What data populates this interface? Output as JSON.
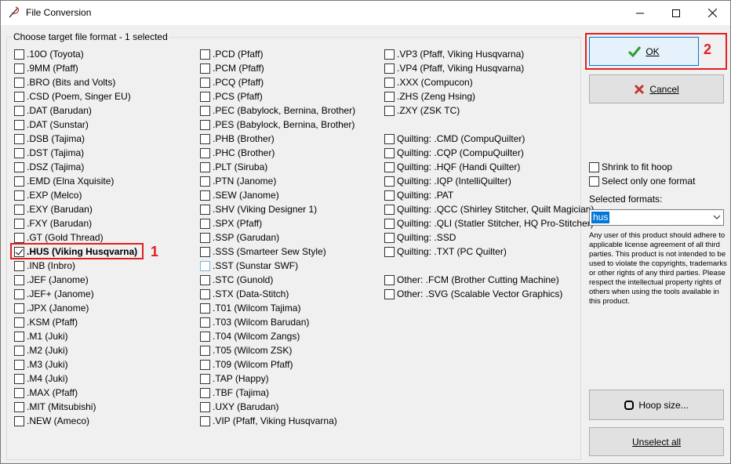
{
  "window": {
    "title": "File Conversion",
    "controls": {
      "minimize": "minimize-icon",
      "maximize": "maximize-icon",
      "close": "close-icon"
    }
  },
  "group": {
    "label": "Choose target file format - 1 selected"
  },
  "columns": [
    [
      {
        "label": ".10O (Toyota)",
        "checked": false
      },
      {
        "label": ".9MM (Pfaff)",
        "checked": false
      },
      {
        "label": ".BRO (Bits and Volts)",
        "checked": false
      },
      {
        "label": ".CSD (Poem, Singer EU)",
        "checked": false
      },
      {
        "label": ".DAT (Barudan)",
        "checked": false
      },
      {
        "label": ".DAT (Sunstar)",
        "checked": false
      },
      {
        "label": ".DSB (Tajima)",
        "checked": false
      },
      {
        "label": ".DST (Tajima)",
        "checked": false
      },
      {
        "label": ".DSZ (Tajima)",
        "checked": false
      },
      {
        "label": ".EMD (Elna Xquisite)",
        "checked": false
      },
      {
        "label": ".EXP (Melco)",
        "checked": false
      },
      {
        "label": ".EXY (Barudan)",
        "checked": false
      },
      {
        "label": ".FXY (Barudan)",
        "checked": false
      },
      {
        "label": ".GT (Gold Thread)",
        "checked": false
      },
      {
        "label": ".HUS (Viking Husqvarna)",
        "checked": true
      },
      {
        "label": ".INB (Inbro)",
        "checked": false
      },
      {
        "label": ".JEF (Janome)",
        "checked": false
      },
      {
        "label": ".JEF+ (Janome)",
        "checked": false
      },
      {
        "label": ".JPX (Janome)",
        "checked": false
      },
      {
        "label": ".KSM (Pfaff)",
        "checked": false
      },
      {
        "label": ".M1 (Juki)",
        "checked": false
      },
      {
        "label": ".M2 (Juki)",
        "checked": false
      },
      {
        "label": ".M3 (Juki)",
        "checked": false
      },
      {
        "label": ".M4 (Juki)",
        "checked": false
      },
      {
        "label": ".MAX (Pfaff)",
        "checked": false
      },
      {
        "label": ".MIT (Mitsubishi)",
        "checked": false
      },
      {
        "label": ".NEW (Ameco)",
        "checked": false
      }
    ],
    [
      {
        "label": ".PCD (Pfaff)",
        "checked": false
      },
      {
        "label": ".PCM (Pfaff)",
        "checked": false
      },
      {
        "label": ".PCQ (Pfaff)",
        "checked": false
      },
      {
        "label": ".PCS (Pfaff)",
        "checked": false
      },
      {
        "label": ".PEC (Babylock, Bernina, Brother)",
        "checked": false
      },
      {
        "label": ".PES (Babylock, Bernina, Brother)",
        "checked": false
      },
      {
        "label": ".PHB (Brother)",
        "checked": false
      },
      {
        "label": ".PHC (Brother)",
        "checked": false
      },
      {
        "label": ".PLT (Siruba)",
        "checked": false
      },
      {
        "label": ".PTN (Janome)",
        "checked": false
      },
      {
        "label": ".SEW (Janome)",
        "checked": false
      },
      {
        "label": ".SHV (Viking Designer 1)",
        "checked": false
      },
      {
        "label": ".SPX (Pfaff)",
        "checked": false
      },
      {
        "label": ".SSP (Garudan)",
        "checked": false
      },
      {
        "label": ".SSS (Smarteer Sew Style)",
        "checked": false
      },
      {
        "label": ".SST (Sunstar SWF)",
        "checked": false
      },
      {
        "label": ".STC (Gunold)",
        "checked": false
      },
      {
        "label": ".STX (Data-Stitch)",
        "checked": false
      },
      {
        "label": ".T01 (Wilcom Tajima)",
        "checked": false
      },
      {
        "label": ".T03 (Wilcom Barudan)",
        "checked": false
      },
      {
        "label": ".T04 (Wilcom Zangs)",
        "checked": false
      },
      {
        "label": ".T05 (Wilcom ZSK)",
        "checked": false
      },
      {
        "label": ".T09 (Wilcom Pfaff)",
        "checked": false
      },
      {
        "label": ".TAP (Happy)",
        "checked": false
      },
      {
        "label": ".TBF (Tajima)",
        "checked": false
      },
      {
        "label": ".UXY (Barudan)",
        "checked": false
      },
      {
        "label": ".VIP (Pfaff, Viking Husqvarna)",
        "checked": false
      }
    ],
    [
      {
        "label": ".VP3 (Pfaff, Viking Husqvarna)",
        "checked": false
      },
      {
        "label": ".VP4 (Pfaff, Viking Husqvarna)",
        "checked": false
      },
      {
        "label": ".XXX (Compucon)",
        "checked": false
      },
      {
        "label": ".ZHS (Zeng Hsing)",
        "checked": false
      },
      {
        "label": ".ZXY (ZSK TC)",
        "checked": false
      },
      null,
      {
        "label": "Quilting: .CMD (CompuQuilter)",
        "checked": false
      },
      {
        "label": "Quilting: .CQP (CompuQuilter)",
        "checked": false
      },
      {
        "label": "Quilting: .HQF (Handi Quilter)",
        "checked": false
      },
      {
        "label": "Quilting: .IQP (IntelliQuilter)",
        "checked": false
      },
      {
        "label": "Quilting: .PAT",
        "checked": false
      },
      {
        "label": "Quilting: .QCC (Shirley Stitcher, Quilt Magician)",
        "checked": false
      },
      {
        "label": "Quilting: .QLI (Statler Stitcher, HQ Pro-Stitcher)",
        "checked": false
      },
      {
        "label": "Quilting: .SSD",
        "checked": false
      },
      {
        "label": "Quilting: .TXT (PC Quilter)",
        "checked": false
      },
      null,
      {
        "label": "Other: .FCM (Brother Cutting Machine)",
        "checked": false
      },
      {
        "label": "Other: .SVG (Scalable Vector Graphics)",
        "checked": false
      }
    ]
  ],
  "annotations": {
    "one": "1",
    "two": "2"
  },
  "buttons": {
    "ok": "OK",
    "cancel": "Cancel",
    "hoop": "Hoop size...",
    "unselect": "Unselect all"
  },
  "options": {
    "shrink": "Shrink to fit hoop",
    "only_one": "Select only one format"
  },
  "selected_formats": {
    "label": "Selected formats:",
    "value": "hus"
  },
  "legal_text": "Any user of this product should adhere to applicable license agreement of all third parties. This product is not intended to be used to violate the copyrights, trademarks or other rights of any third parties. Please respect the intellectual property rights of others when using the tools available in this product.",
  "colors": {
    "annotation": "#e02020",
    "ok_icon": "#2e9e2e",
    "cancel_icon": "#c0392b",
    "selection": "#0078d7"
  }
}
